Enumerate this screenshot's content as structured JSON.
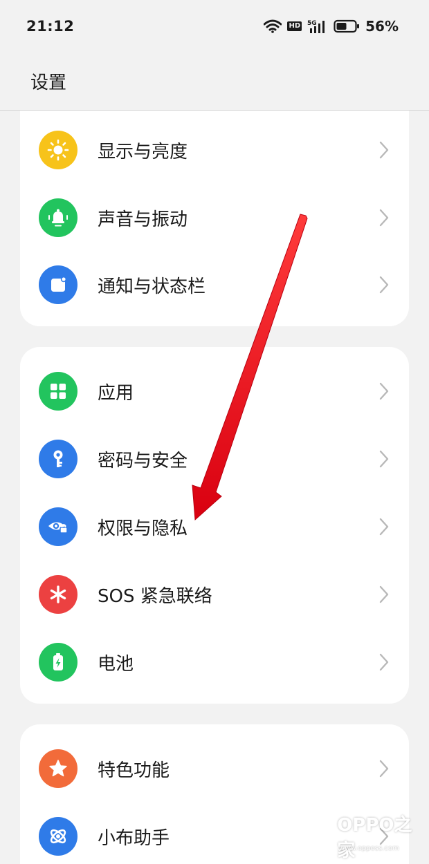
{
  "status_bar": {
    "time": "21:12",
    "hd": "HD",
    "network": "5G",
    "battery_percent": "56%",
    "battery_level": 0.56
  },
  "header": {
    "title": "设置"
  },
  "groups": [
    {
      "items": [
        {
          "label": "显示与亮度",
          "icon": "sun-icon",
          "color": "#f7c31a"
        },
        {
          "label": "声音与振动",
          "icon": "bell-icon",
          "color": "#22c45e"
        },
        {
          "label": "通知与状态栏",
          "icon": "notification-icon",
          "color": "#2f7be8"
        }
      ]
    },
    {
      "items": [
        {
          "label": "应用",
          "icon": "apps-grid-icon",
          "color": "#22c45e"
        },
        {
          "label": "密码与安全",
          "icon": "key-icon",
          "color": "#2f7be8"
        },
        {
          "label": "权限与隐私",
          "icon": "privacy-eye-icon",
          "color": "#2f7be8"
        },
        {
          "label": "SOS 紧急联络",
          "icon": "sos-asterisk-icon",
          "color": "#ec4141"
        },
        {
          "label": "电池",
          "icon": "battery-charge-icon",
          "color": "#22c45e"
        }
      ]
    },
    {
      "items": [
        {
          "label": "特色功能",
          "icon": "star-icon",
          "color": "#f26b3a"
        },
        {
          "label": "小布助手",
          "icon": "assistant-icon",
          "color": "#2f7be8"
        }
      ]
    }
  ],
  "annotation": {
    "arrow_color": "#e8121b"
  },
  "watermark": {
    "text": "OPPO之家",
    "url": "www.opposs.com"
  }
}
